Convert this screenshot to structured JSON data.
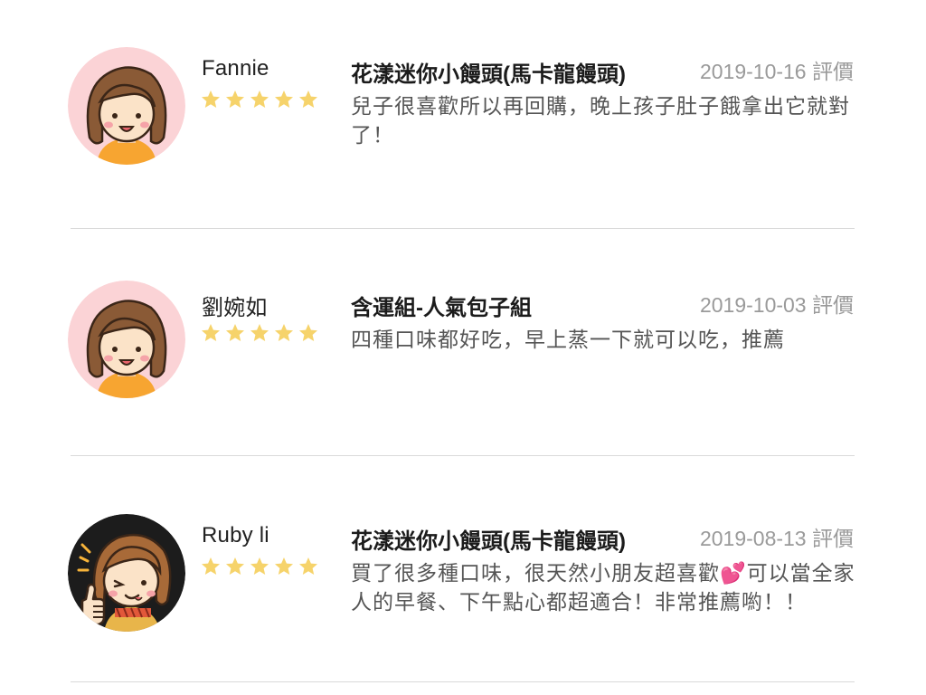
{
  "reviews": [
    {
      "user": "Fannie",
      "rating": 5,
      "product": "花漾迷你小饅頭(馬卡龍饅頭)",
      "date": "2019-10-16 評價",
      "comment": "兒子很喜歡所以再回購，晚上孩子肚子餓拿出它就對了！",
      "avatar_icon": "girl-avatar-icon"
    },
    {
      "user": "劉婉如",
      "rating": 5,
      "product": "含運組-人氣包子組",
      "date": "2019-10-03 評價",
      "comment": "四種口味都好吃，早上蒸一下就可以吃，推薦",
      "avatar_icon": "girl-avatar-icon"
    },
    {
      "user": "Ruby li",
      "rating": 5,
      "product": "花漾迷你小饅頭(馬卡龍饅頭)",
      "date": "2019-08-13 評價",
      "comment": "買了很多種口味，很天然小朋友超喜歡💕可以當全家人的早餐、下午點心都超適合！非常推薦喲！！",
      "avatar_icon": "thumbs-up-girl-avatar-icon"
    }
  ],
  "colors": {
    "star": "#f6d36b",
    "avatar_pink_bg": "#fbd3d6",
    "avatar_dark_bg": "#1c1c1c",
    "hair": "#8a5a36",
    "divider": "#dadada"
  }
}
